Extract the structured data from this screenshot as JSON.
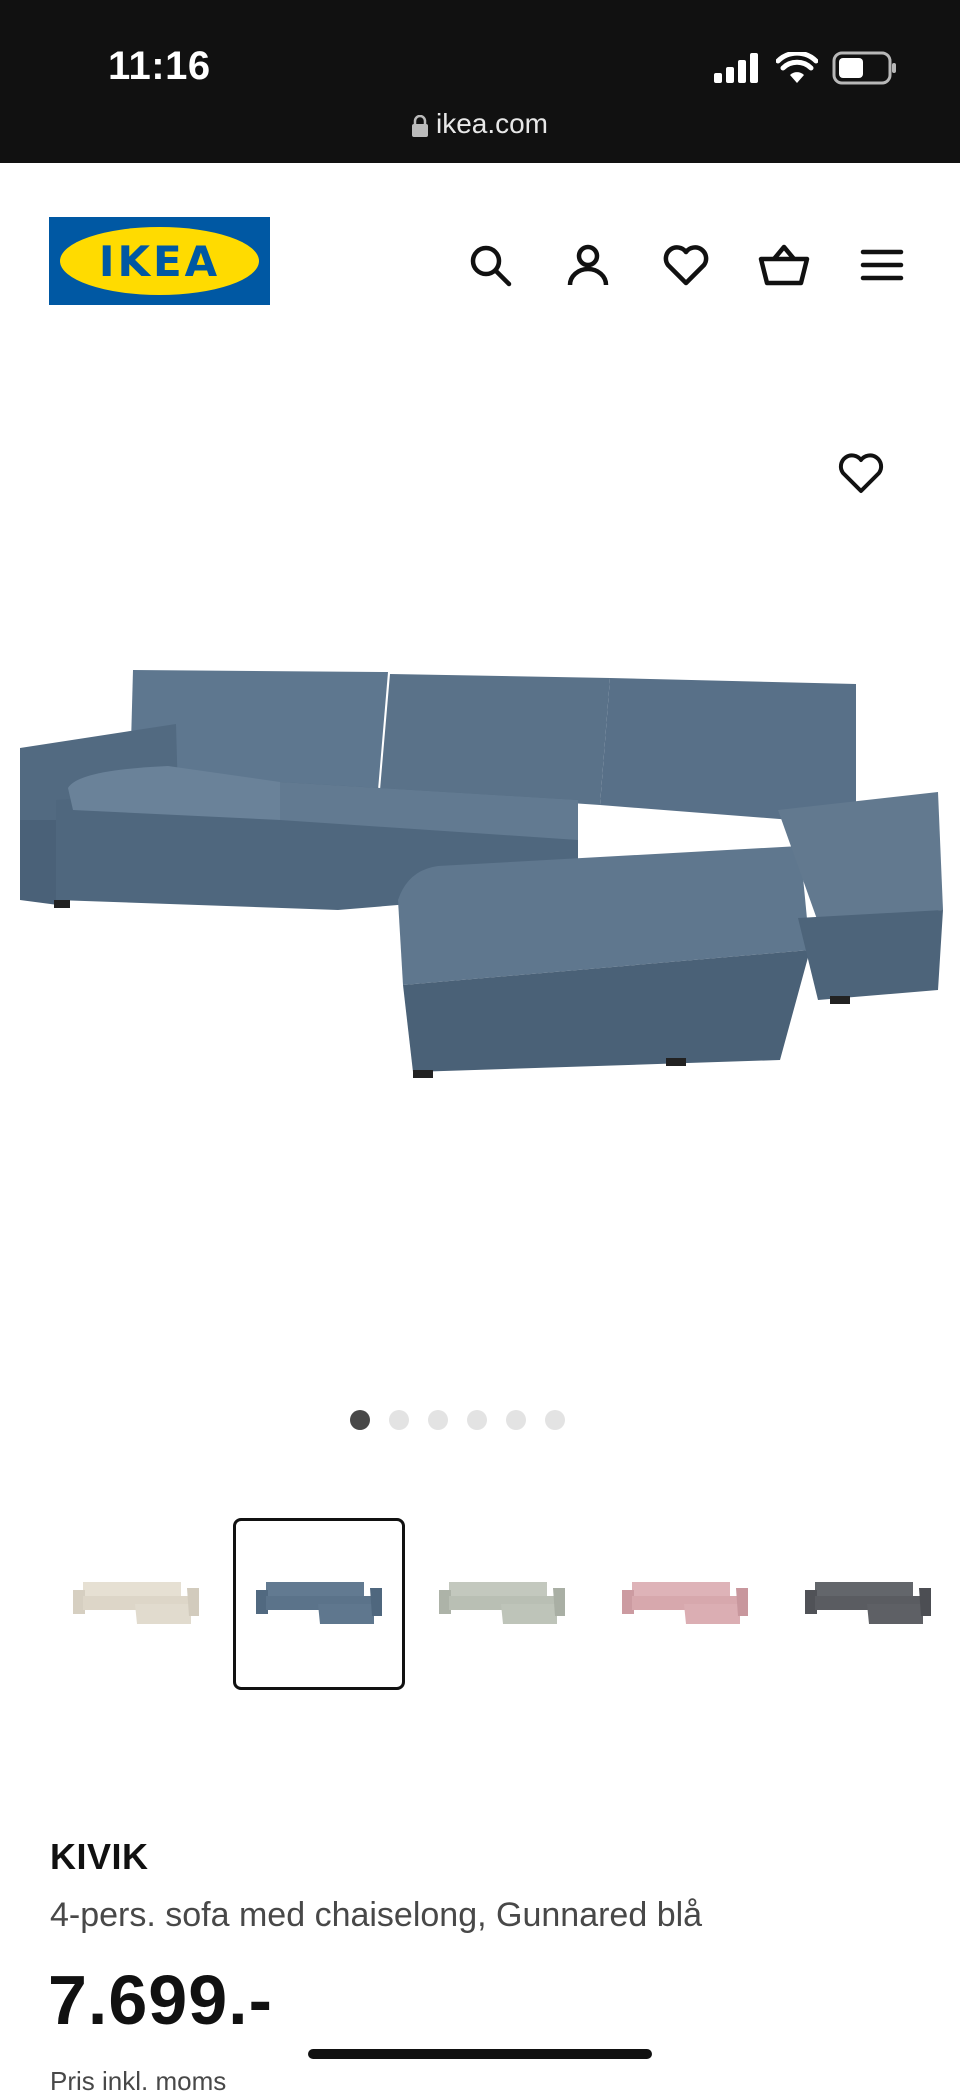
{
  "status_bar": {
    "time": "11:16",
    "url": "ikea.com"
  },
  "header": {
    "logo_text": "IKEA",
    "icons": [
      "search-icon",
      "user-icon",
      "heart-icon",
      "basket-icon",
      "menu-icon"
    ]
  },
  "gallery": {
    "favorite_icon": "heart-icon",
    "image_count": 6,
    "active_index": 0,
    "sofa_color": "#5b738a"
  },
  "variants": [
    {
      "name": "beige",
      "color": "#ddd6c8",
      "selected": false
    },
    {
      "name": "Gunnared blå",
      "color": "#5b738a",
      "selected": true
    },
    {
      "name": "light green-grey",
      "color": "#b9bfb4",
      "selected": false
    },
    {
      "name": "pink",
      "color": "#d7a8ad",
      "selected": false
    },
    {
      "name": "dark grey",
      "color": "#5a5c61",
      "selected": false
    }
  ],
  "product": {
    "name": "KIVIK",
    "description": "4-pers. sofa med chaiselong, Gunnared blå",
    "price": "7.699.-",
    "price_note": "Pris inkl. moms"
  },
  "colors": {
    "brand_blue": "#0058A3",
    "brand_yellow": "#FFDB00"
  }
}
